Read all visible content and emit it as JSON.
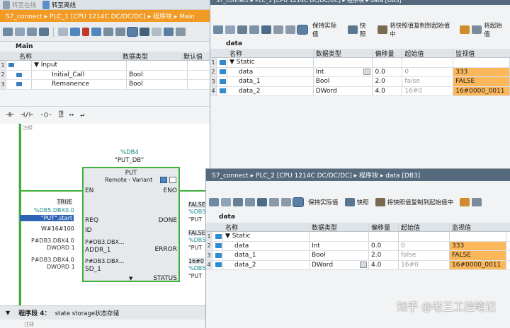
{
  "left_editor": {
    "breadcrumb": "S7_connect ▸ PLC_1 [CPU 1214C DC/DC/DC] ▸ 程序块 ▸ Main",
    "online_btn": "转至在线",
    "offline_btn": "转至离线",
    "block_name": "Main",
    "interface_headers": [
      "名称",
      "数据类型",
      "默认值"
    ],
    "interface_rows": [
      {
        "num": "1",
        "name": "▼ Input",
        "type": ""
      },
      {
        "num": "2",
        "name": "Initial_Call",
        "type": "Bool"
      },
      {
        "num": "3",
        "name": "Remanence",
        "type": "Bool"
      }
    ],
    "comment": "注释",
    "db_tag": "%DB4",
    "db_name": "\"PUT_DB\"",
    "block": {
      "title": "PUT",
      "subtitle": "Remote - Variant",
      "en": "EN",
      "eno": "ENO",
      "req": "REQ",
      "id": "ID",
      "addr1": "ADDR_1",
      "sd1": "SD_1",
      "done": "DONE",
      "error": "ERROR",
      "status": "STATUS",
      "p1": "P#DB3.DBX...",
      "p2": "P#DB3.DBX..."
    },
    "inputs": {
      "true": "TRUE",
      "req_addr": "%DB5.DBX0.0",
      "req_sym": "\"PUT\".start",
      "id_val": "W#16#100",
      "addr_p": "P#DB3.DBX4.0",
      "addr_t": "DWORD 1",
      "sd_p": "P#DB3.DBX4.0",
      "sd_t": "DWORD 1"
    },
    "outputs": {
      "done_v": "FALSE",
      "done_a": "%DB5",
      "done_s": "\"PUT",
      "err_v": "FALSE",
      "err_a": "%DB5",
      "err_s": "\"PUT",
      "st_v": "16#0",
      "st_a": "%DB5",
      "st_s": "\"PUT"
    },
    "network_label": "程序段 4：",
    "network_title": "state storage状态存储",
    "network_comment": "注释"
  },
  "top_db": {
    "breadcrumb": "S7_connect ▸ PLC_1 [CPU 1214C DC/DC/DC] ▸ 程序块 ▸ data [DB3]",
    "btn_keep": "保持实际值",
    "btn_snapshot": "快照",
    "btn_copy": "将快照值复制到起始值中",
    "btn_copy2": "将起始值",
    "title": "data",
    "headers": [
      "名称",
      "数据类型",
      "偏移量",
      "起始值",
      "监视值"
    ],
    "rows": [
      {
        "num": "1",
        "name": "▼ Static",
        "type": "",
        "offset": "",
        "start": "",
        "monitor": ""
      },
      {
        "num": "2",
        "name": "data",
        "type": "Int",
        "offset": "0.0",
        "start": "0",
        "monitor": "333"
      },
      {
        "num": "3",
        "name": "data_1",
        "type": "Bool",
        "offset": "2.0",
        "start": "false",
        "monitor": "FALSE"
      },
      {
        "num": "4",
        "name": "data_2",
        "type": "DWord",
        "offset": "4.0",
        "start": "16#0",
        "monitor": "16#0000_0011"
      }
    ]
  },
  "bottom_db": {
    "breadcrumb": "S7_connect ▸ PLC_2 [CPU 1214C DC/DC/DC] ▸ 程序块 ▸ data [DB3]",
    "btn_keep": "保持实际值",
    "btn_snapshot": "快照",
    "btn_copy": "将快照值复制到起始值中",
    "title": "data",
    "headers": [
      "名称",
      "数据类型",
      "偏移量",
      "起始值",
      "监视值"
    ],
    "rows": [
      {
        "num": "1",
        "name": "▼ Static",
        "type": "",
        "offset": "",
        "start": "",
        "monitor": ""
      },
      {
        "num": "2",
        "name": "data",
        "type": "Int",
        "offset": "0.0",
        "start": "0",
        "monitor": "333"
      },
      {
        "num": "3",
        "name": "data_1",
        "type": "Bool",
        "offset": "2.0",
        "start": "false",
        "monitor": "FALSE"
      },
      {
        "num": "4",
        "name": "data_2",
        "type": "DWord",
        "offset": "4.0",
        "start": "16#0",
        "monitor": "16#0000_0011"
      }
    ]
  },
  "watermark": "知乎 @老王工控笔记",
  "colors": {
    "green": "#3fb13a",
    "monitor_orange": "#fcb75b",
    "title_blue": "#566a7d",
    "title_orange": "#f39a24",
    "teal": "#1d8a8a"
  }
}
